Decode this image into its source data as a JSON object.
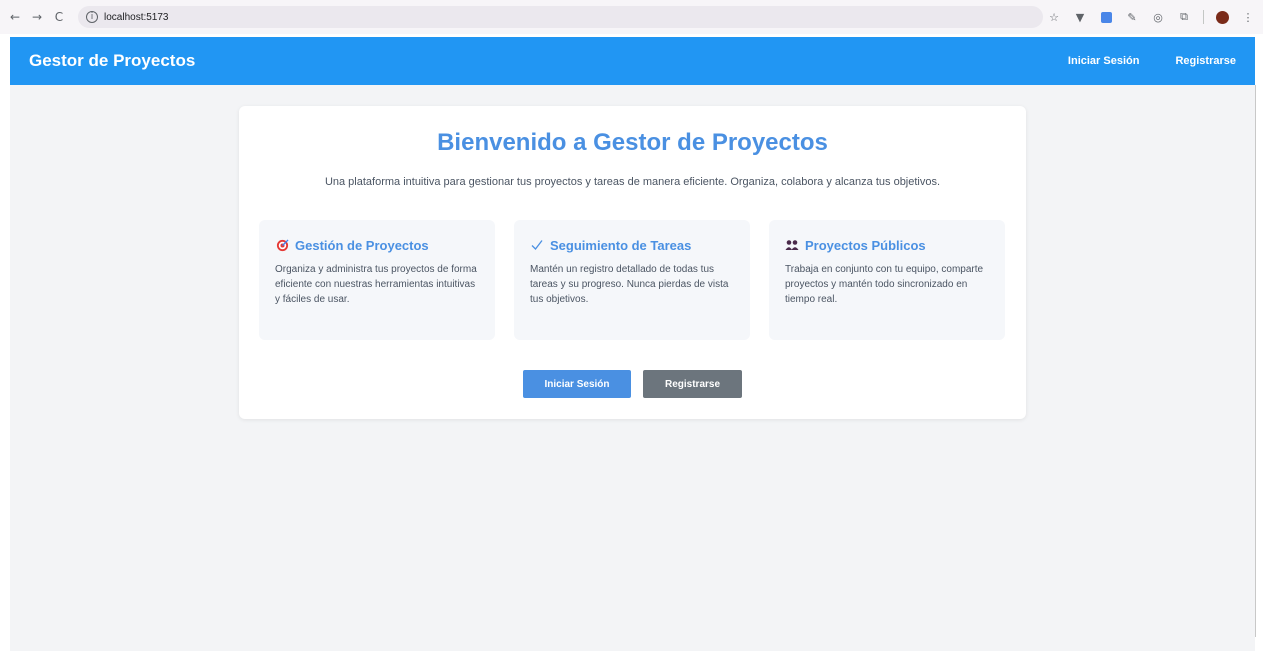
{
  "browser": {
    "url": "localhost:5173",
    "nav": {
      "back": "←",
      "forward": "→",
      "reload": "C"
    }
  },
  "header": {
    "brand": "Gestor de Proyectos",
    "login_label": "Iniciar Sesión",
    "register_label": "Registrarse"
  },
  "hero": {
    "title": "Bienvenido a Gestor de Proyectos",
    "subtitle": "Una plataforma intuitiva para gestionar tus proyectos y tareas de manera eficiente. Organiza, colabora y alcanza tus objetivos."
  },
  "features": [
    {
      "icon": "target-icon",
      "title": "Gestión de Proyectos",
      "text": "Organiza y administra tus proyectos de forma eficiente con nuestras herramientas intuitivas y fáciles de usar."
    },
    {
      "icon": "checkmark-icon",
      "title": "Seguimiento de Tareas",
      "text": "Mantén un registro detallado de todas tus tareas y su progreso. Nunca pierdas de vista tus objetivos."
    },
    {
      "icon": "people-icon",
      "title": "Proyectos Públicos",
      "text": "Trabaja en conjunto con tu equipo, comparte proyectos y mantén todo sincronizado en tiempo real."
    }
  ],
  "actions": {
    "login_label": "Iniciar Sesión",
    "register_label": "Registrarse"
  },
  "colors": {
    "header_bg": "#2196f3",
    "accent": "#4a90e2",
    "secondary_button": "#6c757d",
    "page_bg": "#f3f4f6"
  }
}
